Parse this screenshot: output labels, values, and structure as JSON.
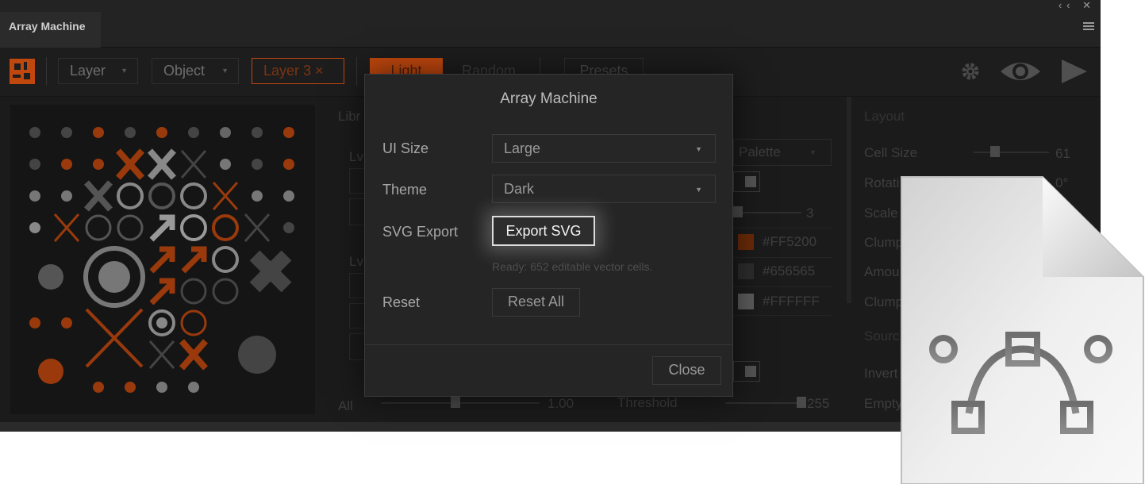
{
  "window": {
    "title": "Array Machine",
    "controls": "‹‹ ✕"
  },
  "toolbar": {
    "layer_dropdown": "Layer",
    "object_dropdown": "Object",
    "active_layer": "Layer 3 ×",
    "mode_light": "Light",
    "mode_random": "Random",
    "presets": "Presets"
  },
  "panels": {
    "library_label": "Libr",
    "lvl_label_1": "Lvl",
    "lvl_label_2": "Lvl",
    "all_label": "All",
    "all_value": "1.00",
    "palette_dropdown": "Palette",
    "palette_count": "3",
    "palette_colors": [
      "#FF5200",
      "#656565",
      "#FFFFFF"
    ],
    "threshold_label": "Threshold",
    "threshold_value": "255"
  },
  "layout_panel": {
    "heading": "Layout",
    "cell_size_label": "Cell Size",
    "cell_size_value": "61",
    "rotation_label": "Rotati",
    "rotation_value": "0°",
    "scale_label": "Scale .",
    "clump_label": "Clump",
    "amount_label": "Amou",
    "clump2_label": "Clump",
    "source_label": "Sourc",
    "invert_label": "Invert",
    "empty_label": "Empty"
  },
  "modal": {
    "title": "Array Machine",
    "ui_size_label": "UI Size",
    "ui_size_value": "Large",
    "theme_label": "Theme",
    "theme_value": "Dark",
    "svg_export_label": "SVG Export",
    "export_button": "Export SVG",
    "export_hint": "Ready: 652 editable vector cells.",
    "reset_label": "Reset",
    "reset_button": "Reset All",
    "close_button": "Close"
  },
  "colors": {
    "accent": "#FF5200",
    "gray": "#656565",
    "white": "#FFFFFF",
    "panel_bg": "#1b1b1b"
  },
  "icons": [
    "logo-icon",
    "gear-icon",
    "eye-icon",
    "play-icon",
    "svg-file-icon",
    "bezier-curve-icon"
  ]
}
